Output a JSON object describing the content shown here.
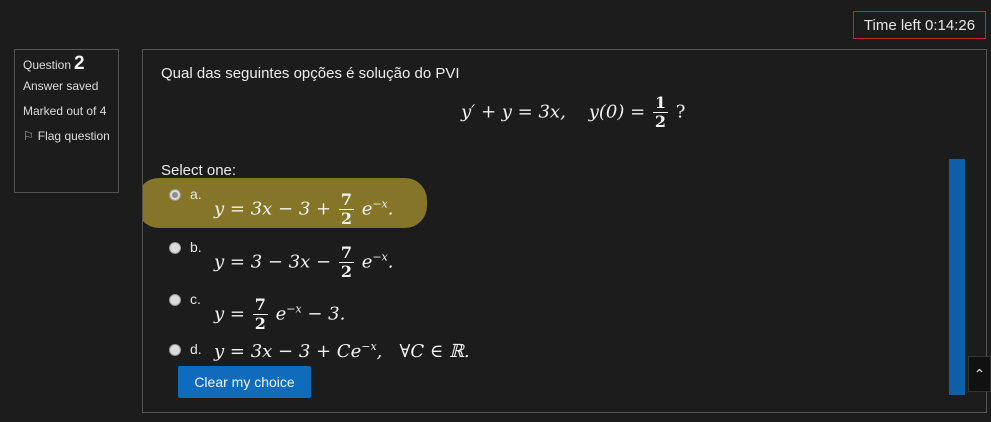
{
  "timer": {
    "label": "Time left 0:14:26"
  },
  "question_info": {
    "question_word": "Question",
    "number": "2",
    "state": "Answer saved",
    "marks": "Marked out of 4",
    "flag_label": "Flag question",
    "flag_icon": "flag-outline-icon"
  },
  "question": {
    "text": "Qual das seguintes opções é solução do PVI",
    "equation": {
      "lhs": "y′ + y = 3x,",
      "ic": "y(0) =",
      "ic_num": "1",
      "ic_den": "2",
      "end": "?"
    },
    "select_label": "Select one:"
  },
  "options": [
    {
      "letter": "a.",
      "checked": true,
      "pre": "y = 3x − 3 + ",
      "num": "7",
      "den": "2",
      "post": "e",
      "exp": "−x",
      "tail": "."
    },
    {
      "letter": "b.",
      "checked": false,
      "pre": "y = 3 − 3x − ",
      "num": "7",
      "den": "2",
      "post": "e",
      "exp": "−x",
      "tail": "."
    },
    {
      "letter": "c.",
      "checked": false,
      "pre": "y = ",
      "num": "7",
      "den": "2",
      "post": "e",
      "exp": "−x",
      "tail": " − 3."
    },
    {
      "letter": "d.",
      "checked": false,
      "text1": "y = 3x − 3 + Ce",
      "exp": "−x",
      "text2": ",   ∀C ∈ ℝ."
    }
  ],
  "buttons": {
    "clear": "Clear my choice",
    "scroll_top_icon": "chevron-up-icon"
  },
  "colors": {
    "highlight": "#8a7a2a",
    "button": "#0f6cbd",
    "timer_border": "#b03030",
    "scrollbar": "#0d5fa8"
  }
}
